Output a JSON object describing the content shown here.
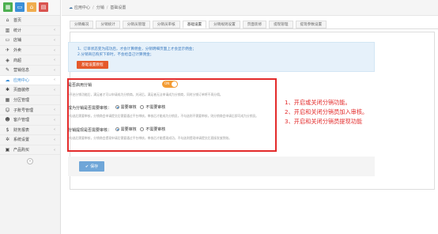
{
  "sidebar": {
    "top_buttons": [
      {
        "icon": "grid-icon",
        "glyph": "▦",
        "color": "#4caf50"
      },
      {
        "icon": "monitor-icon",
        "glyph": "▭",
        "color": "#3b8fd8"
      },
      {
        "icon": "store-icon",
        "glyph": "⌂",
        "color": "#f0ad4e"
      },
      {
        "icon": "shop-icon",
        "glyph": "▤",
        "color": "#d9534f"
      }
    ],
    "items": [
      {
        "label": "首页",
        "icon": "home-icon",
        "glyph": "⌂",
        "chevron": false
      },
      {
        "label": "统计",
        "icon": "chart-icon",
        "glyph": "▥",
        "chevron": true
      },
      {
        "label": "店铺",
        "icon": "shop-icon",
        "glyph": "▭",
        "chevron": true
      },
      {
        "label": "外卖",
        "icon": "delivery-icon",
        "glyph": "✈",
        "chevron": true
      },
      {
        "label": "商超",
        "icon": "cart-icon",
        "glyph": "◈",
        "chevron": true
      },
      {
        "label": "营销信息",
        "icon": "news-icon",
        "glyph": "✎",
        "chevron": true
      },
      {
        "label": "应用中心",
        "icon": "cloud-icon",
        "glyph": "☁",
        "chevron": true,
        "active": true
      },
      {
        "label": "页面装修",
        "icon": "brush-icon",
        "glyph": "✱",
        "chevron": true
      },
      {
        "label": "分区管理",
        "icon": "grid-icon",
        "glyph": "▦",
        "chevron": false
      },
      {
        "label": "子账号管理",
        "icon": "user-icon",
        "glyph": "☺",
        "chevron": true
      },
      {
        "label": "客户管理",
        "icon": "customer-icon",
        "glyph": "☻",
        "chevron": true
      },
      {
        "label": "财务报表",
        "icon": "finance-icon",
        "glyph": "$",
        "chevron": true
      },
      {
        "label": "系统设置",
        "icon": "gear-icon",
        "glyph": "✲",
        "chevron": true
      },
      {
        "label": "产品购买",
        "icon": "bag-icon",
        "glyph": "▣",
        "chevron": true
      }
    ],
    "collapse_glyph": "«"
  },
  "breadcrumb": {
    "items": [
      "应用中心",
      "分销",
      "基础设置"
    ],
    "separator": "/"
  },
  "tabs": [
    {
      "label": "分销概况",
      "active": false
    },
    {
      "label": "分销统计",
      "active": false
    },
    {
      "label": "分销员管理",
      "active": false
    },
    {
      "label": "分销员审核",
      "active": false
    },
    {
      "label": "基础设置",
      "active": true
    },
    {
      "label": "分销规则设置",
      "active": false
    },
    {
      "label": "页面装修",
      "active": false
    },
    {
      "label": "提现管理",
      "active": false
    },
    {
      "label": "提现参数设置",
      "active": false
    }
  ],
  "notice": {
    "line1": "1、订单状态变为成功后，才会计算佣金，分销明细页面上才会显示佣金；",
    "line2": "2.分销商已购买下单时，不会给自己计算佣金；",
    "tutorial_button": "基础设置教程"
  },
  "form": {
    "enable_distribution": {
      "label": "是否启用分销",
      "toggle_text": "ON",
      "hint": "*开启分销功能后，满足者才可以申请成为分销商。关闭后，满足者无法申请成为分销商，同时分销订单将不再分佣。"
    },
    "join_review": {
      "label": "成为分销是否需要审核：",
      "option_yes": "需要审核",
      "option_no": "不需要审核",
      "hint": "*勾选后需要审核，分销商会申请提交后需要通过平台审核，审核后才能成为分销员，不勾选则不需要审核，则分销商会申请后即可成为分销员。"
    },
    "withdraw_review": {
      "label": "分销提现是否需要审核：",
      "option_yes": "需要审核",
      "option_no": "不需要审核",
      "hint": "*勾选后需要审核，分销商会提现申请后需要通过平台审核，审核后才能提现成功，不勾选则提现申请提交后直接发放到账。"
    }
  },
  "annotations": [
    "1、开启或关闭分销功能。",
    "2、开启和关闭分销员加入审核。",
    "3、开启和关闭分销员提现功能"
  ],
  "save_button": {
    "icon": "check-icon",
    "glyph": "✔",
    "label": "保存"
  },
  "colors": {
    "accent": "#3b8fd8",
    "toggle_on": "#f39c34",
    "tutorial": "#e55a2b",
    "highlight": "#e32a2a",
    "save": "#6fa6d8",
    "notice_bg": "#e6f1fa"
  }
}
